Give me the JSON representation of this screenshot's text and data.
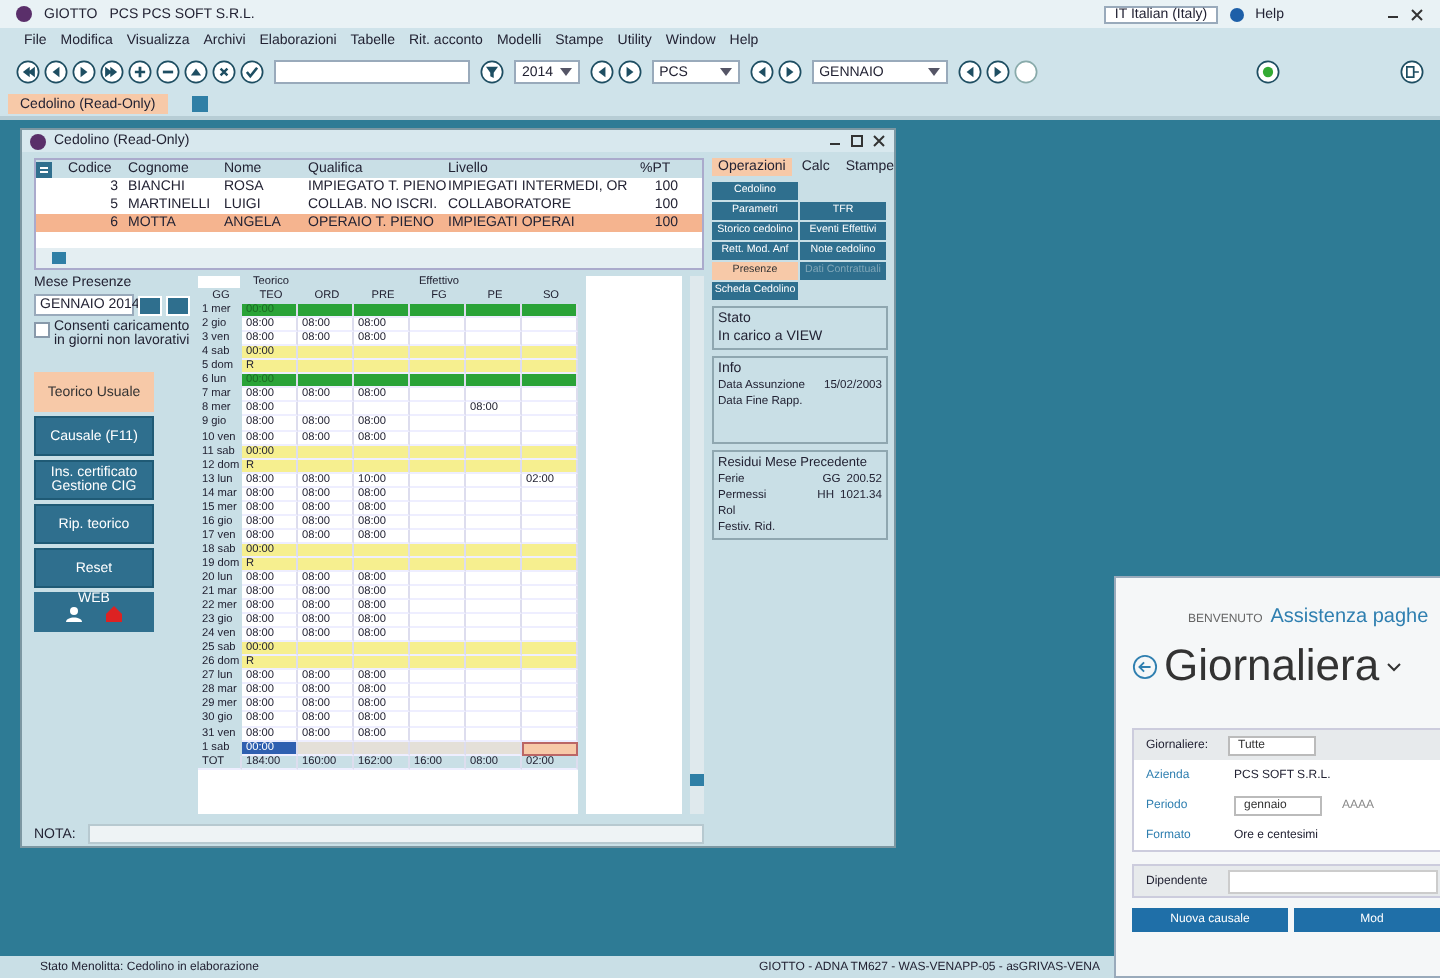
{
  "app_bar": {
    "app_name": "GIOTTO",
    "company": "PCS  PCS SOFT S.R.L.",
    "language": "IT Italian (Italy)",
    "help": "Help"
  },
  "menu": [
    "File",
    "Modifica",
    "Visualizza",
    "Archivi",
    "Elaborazioni",
    "Tabelle",
    "Rit. acconto",
    "Modelli",
    "Stampe",
    "Utility",
    "Window",
    "Help"
  ],
  "toolbar": {
    "year": "2014",
    "company_code": "PCS",
    "month": "GENNAIO"
  },
  "doc_tab": {
    "label": "Cedolino (Read-Only)"
  },
  "window": {
    "title": "Cedolino (Read-Only)"
  },
  "employees": {
    "columns": [
      "Codice",
      "Cognome",
      "Nome",
      "Qualifica",
      "Livello",
      "%PT"
    ],
    "rows": [
      {
        "cells": [
          "3",
          "BIANCHI",
          "ROSA",
          "IMPIEGATO T. PIENO",
          "IMPIEGATI INTERMEDI, OR",
          "100"
        ],
        "selected": false
      },
      {
        "cells": [
          "5",
          "MARTINELLI",
          "LUIGI",
          "COLLAB. NO ISCRI.",
          "COLLABORATORE",
          "100"
        ],
        "selected": false
      },
      {
        "cells": [
          "6",
          "MOTTA",
          "ANGELA",
          "OPERAIO T. PIENO",
          "IMPIEGATI OPERAI",
          "100"
        ],
        "selected": true
      }
    ]
  },
  "side_tabs": [
    {
      "label": "Operazioni",
      "selected": true
    },
    {
      "label": "Calc",
      "selected": false
    },
    {
      "label": "Stampe",
      "selected": false
    }
  ],
  "operations": {
    "left": [
      {
        "label": "Cedolino",
        "selected": false,
        "disabled": false
      },
      {
        "label": "Parametri",
        "selected": false,
        "disabled": false
      },
      {
        "label": "Storico cedolino",
        "selected": false,
        "disabled": false
      },
      {
        "label": "Rett. Mod. Anf",
        "selected": false,
        "disabled": false
      },
      {
        "label": "Presenze",
        "selected": true,
        "disabled": false
      },
      {
        "label": "Scheda Cedolino",
        "selected": false,
        "disabled": false
      }
    ],
    "right": [
      {
        "label": "TFR",
        "selected": false,
        "disabled": false
      },
      {
        "label": "Eventi Effettivi",
        "selected": false,
        "disabled": false
      },
      {
        "label": "Note cedolino",
        "selected": false,
        "disabled": false
      },
      {
        "label": "Dati Contrattuali",
        "selected": false,
        "disabled": true
      }
    ]
  },
  "stato": {
    "title": "Stato",
    "text": "In carico a VIEW"
  },
  "info": {
    "title": "Info",
    "rows": [
      {
        "label": "Data Assunzione",
        "value": "15/02/2003"
      },
      {
        "label": "Data Fine Rapp."
      }
    ]
  },
  "residui": {
    "title": "Residui Mese Precedente",
    "rows": [
      {
        "label": "Ferie",
        "unit": "GG",
        "value": "200.52"
      },
      {
        "label": "Permessi",
        "unit": "HH",
        "value": "1021.34"
      },
      {
        "label": "Rol"
      },
      {
        "label": "Festiv. Rid."
      }
    ]
  },
  "month_panel": {
    "label": "Mese Presenze",
    "value": "GENNAIO 2014",
    "option": {
      "label": "Consenti caricamento in giorni non lavorativi",
      "checked": false
    }
  },
  "actions": [
    {
      "label": "Teorico Usuale",
      "selected": true
    },
    {
      "label": "Causale (F11)",
      "selected": false
    },
    {
      "label": "Ins. certificato Gestione CIG",
      "selected": false
    },
    {
      "label": "Rip. teorico",
      "selected": false
    },
    {
      "label": "Reset",
      "selected": false
    }
  ],
  "web_button": {
    "label": "WEB"
  },
  "grid": {
    "day_column": "GG",
    "groups": [
      {
        "label": "Teorico",
        "columns": [
          "TEO"
        ]
      },
      {
        "label": "Effettivo",
        "columns": [
          "ORD",
          "PRE",
          "FG",
          "PE",
          "SO"
        ]
      }
    ],
    "rows": [
      {
        "day": "1 mer",
        "kind": "holiday",
        "cells": [
          "00:00"
        ]
      },
      {
        "day": "2 gio",
        "kind": "work",
        "cells": [
          "08:00",
          "08:00",
          "08:00"
        ]
      },
      {
        "day": "3 ven",
        "kind": "work",
        "cells": [
          "08:00",
          "08:00",
          "08:00"
        ]
      },
      {
        "day": "4 sab",
        "kind": "saturday",
        "cells": [
          "00:00"
        ]
      },
      {
        "day": "5 dom",
        "kind": "sunday",
        "cells": [
          "R"
        ]
      },
      {
        "day": "6 lun",
        "kind": "holiday",
        "cells": [
          "00:00"
        ]
      },
      {
        "day": "7 mar",
        "kind": "work",
        "cells": [
          "08:00",
          "08:00",
          "08:00"
        ]
      },
      {
        "day": "8 mer",
        "kind": "work",
        "cells": [
          "08:00",
          null,
          null,
          null,
          "08:00"
        ]
      },
      {
        "day": "9 gio",
        "kind": "work",
        "cells": [
          "08:00",
          "08:00",
          "08:00"
        ]
      },
      {
        "day": "10 ven",
        "kind": "work",
        "cells": [
          "08:00",
          "08:00",
          "08:00"
        ]
      },
      {
        "day": "11 sab",
        "kind": "saturday",
        "cells": [
          "00:00"
        ]
      },
      {
        "day": "12 dom",
        "kind": "sunday",
        "cells": [
          "R"
        ]
      },
      {
        "day": "13 lun",
        "kind": "work",
        "cells": [
          "08:00",
          "08:00",
          "10:00",
          null,
          null,
          "02:00"
        ]
      },
      {
        "day": "14 mar",
        "kind": "work",
        "cells": [
          "08:00",
          "08:00",
          "08:00"
        ]
      },
      {
        "day": "15 mer",
        "kind": "work",
        "cells": [
          "08:00",
          "08:00",
          "08:00"
        ]
      },
      {
        "day": "16 gio",
        "kind": "work",
        "cells": [
          "08:00",
          "08:00",
          "08:00"
        ]
      },
      {
        "day": "17 ven",
        "kind": "work",
        "cells": [
          "08:00",
          "08:00",
          "08:00"
        ]
      },
      {
        "day": "18 sab",
        "kind": "saturday",
        "cells": [
          "00:00"
        ]
      },
      {
        "day": "19 dom",
        "kind": "sunday",
        "cells": [
          "R"
        ]
      },
      {
        "day": "20 lun",
        "kind": "work",
        "cells": [
          "08:00",
          "08:00",
          "08:00"
        ]
      },
      {
        "day": "21 mar",
        "kind": "work",
        "cells": [
          "08:00",
          "08:00",
          "08:00"
        ]
      },
      {
        "day": "22 mer",
        "kind": "work",
        "cells": [
          "08:00",
          "08:00",
          "08:00"
        ]
      },
      {
        "day": "23 gio",
        "kind": "work",
        "cells": [
          "08:00",
          "08:00",
          "08:00"
        ]
      },
      {
        "day": "24 ven",
        "kind": "work",
        "cells": [
          "08:00",
          "08:00",
          "08:00"
        ]
      },
      {
        "day": "25 sab",
        "kind": "saturday",
        "cells": [
          "00:00"
        ]
      },
      {
        "day": "26 dom",
        "kind": "sunday",
        "cells": [
          "R"
        ]
      },
      {
        "day": "27 lun",
        "kind": "work",
        "cells": [
          "08:00",
          "08:00",
          "08:00"
        ]
      },
      {
        "day": "28 mar",
        "kind": "work",
        "cells": [
          "08:00",
          "08:00",
          "08:00"
        ]
      },
      {
        "day": "29 mer",
        "kind": "work",
        "cells": [
          "08:00",
          "08:00",
          "08:00"
        ]
      },
      {
        "day": "30 gio",
        "kind": "work",
        "cells": [
          "08:00",
          "08:00",
          "08:00"
        ]
      },
      {
        "day": "31 ven",
        "kind": "work",
        "cells": [
          "08:00",
          "08:00",
          "08:00"
        ]
      },
      {
        "day": "1 sab",
        "kind": "next_month",
        "cells": [
          "00:00"
        ]
      }
    ],
    "totals": {
      "label": "TOT",
      "cells": [
        "184:00",
        "160:00",
        "162:00",
        "16:00",
        "08:00",
        "02:00"
      ]
    }
  },
  "note": {
    "label": "NOTA:"
  },
  "web": {
    "welcome": "BENVENUTO",
    "user": "Assistenza paghe",
    "title": "Giornaliera",
    "filter": {
      "label": "Giornaliere:",
      "value": "Tutte"
    },
    "rows": [
      {
        "label": "Azienda",
        "value": "PCS SOFT S.R.L."
      },
      {
        "label": "Periodo",
        "select": "gennaio",
        "year": "AAAA"
      },
      {
        "label": "Formato",
        "value": "Ore e centesimi"
      }
    ],
    "employee_field": {
      "label": "Dipendente"
    },
    "buttons": [
      "Nuova causale",
      "Mod"
    ]
  },
  "status_bar": {
    "left": "Stato Menolitta: Cedolino in elaborazione",
    "right": "GIOTTO - ADNA TM627 - WAS-VENAPP-05 - asGRIVAS-VENA"
  }
}
